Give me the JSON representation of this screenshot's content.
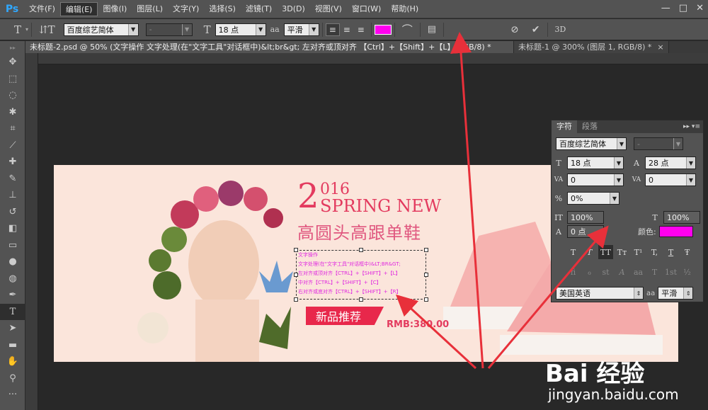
{
  "app": {
    "logo": "Ps"
  },
  "menu": [
    "文件(F)",
    "编辑(E)",
    "图像(I)",
    "图层(L)",
    "文字(Y)",
    "选择(S)",
    "滤镜(T)",
    "3D(D)",
    "视图(V)",
    "窗口(W)",
    "帮助(H)"
  ],
  "window_controls": {
    "minimize": "—",
    "maximize": "□",
    "close": "✕"
  },
  "options": {
    "font_family": "百度综艺简体",
    "font_style": "-",
    "font_size": "18 点",
    "antialias_label": "aa",
    "antialias": "平滑",
    "color": "#ff00ee"
  },
  "tabs": [
    {
      "label": "未标题-2.psd @ 50% (文字操作 文字处理(在\"文字工具\"对话框中)&lt;br&gt;  左对齐或顶对齐 【Ctrl】+【Shift】+【L】  RGB/8) *",
      "close": "×"
    },
    {
      "label": "未标题-1 @ 300% (图层 1, RGB/8) *",
      "close": "×"
    }
  ],
  "banner": {
    "year_big": "2",
    "year_small": "016",
    "spring": "SPRING NEW",
    "headline": "高圆头高跟单鞋",
    "frame_lines": [
      "文字操作",
      "文字处理(在\"文字工具\"对话框中)&LT;BR&GT;",
      "左对齐或顶对齐【CTRL】+【SHIFT】+【L】",
      "中对齐【CTRL】+【SHIFT】+【C】",
      "右对齐或底对齐【CTRL】+【SHIFT】+【R】"
    ],
    "badge": "新品推荐",
    "price": "RMB:380.00"
  },
  "char_panel": {
    "tabs": [
      "字符",
      "段落"
    ],
    "font_family": "百度综艺简体",
    "font_style": "-",
    "font_size": "18 点",
    "leading": "28 点",
    "kerning": "0",
    "tracking": "0",
    "tsume": "0%",
    "vscale": "100%",
    "hscale": "100%",
    "baseline": "0 点",
    "color_label": "颜色:",
    "color": "#ff00ee",
    "style_buttons": [
      "T",
      "T",
      "TT",
      "Tт",
      "T¹",
      "T,",
      "T",
      "Ŧ"
    ],
    "opentype_buttons": [
      "fi",
      "ℴ",
      "st",
      "A",
      "aa",
      "T",
      "1st",
      "½"
    ],
    "language": "美国英语",
    "antialias": "平滑"
  },
  "watermark": {
    "logo": "Bai 经验",
    "url": "jingyan.baidu.com"
  },
  "colors": {
    "accent_red": "#e33b5f",
    "arrow": "#e8303a",
    "magenta": "#ff00ee"
  }
}
